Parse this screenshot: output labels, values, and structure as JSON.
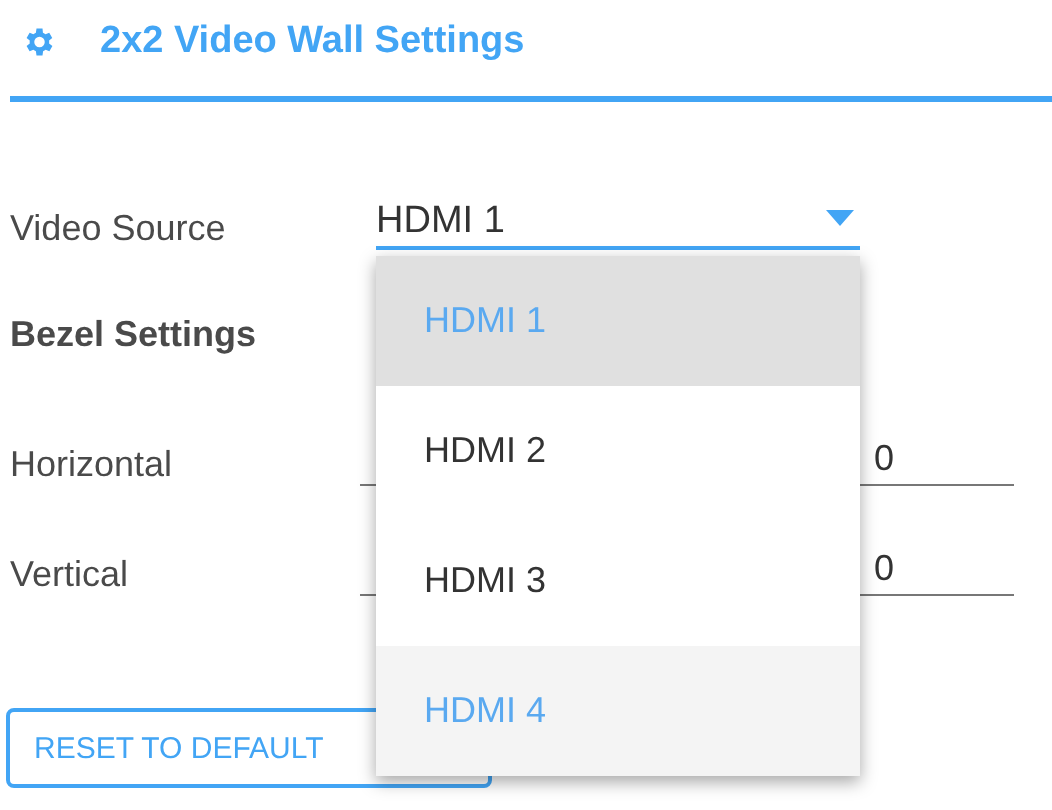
{
  "header": {
    "title": "2x2 Video Wall Settings"
  },
  "video_source": {
    "label": "Video Source",
    "value": "HDMI 1",
    "expanded": true,
    "options": [
      {
        "label": "HDMI 1",
        "selected": true,
        "hovered": false
      },
      {
        "label": "HDMI 2",
        "selected": false,
        "hovered": false
      },
      {
        "label": "HDMI 3",
        "selected": false,
        "hovered": false
      },
      {
        "label": "HDMI 4",
        "selected": false,
        "hovered": true
      }
    ]
  },
  "bezel": {
    "title": "Bezel Settings",
    "rows": [
      {
        "label": "Horizontal",
        "value_end": "0"
      },
      {
        "label": "Vertical",
        "value_end": "0"
      }
    ]
  },
  "buttons": [
    "RESET TO DEFAULT"
  ]
}
